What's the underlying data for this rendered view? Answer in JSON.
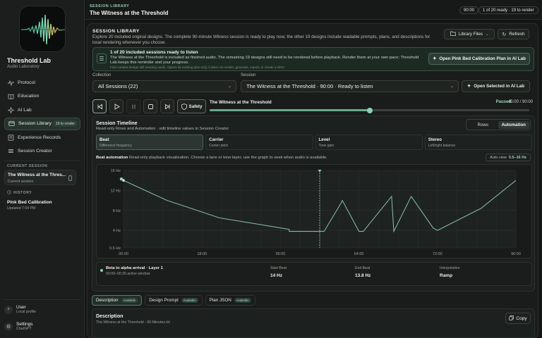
{
  "app": {
    "title": "Threshold Lab",
    "subtitle": "Audio Laboratory"
  },
  "sidebar": {
    "items": [
      {
        "label": "Protocol",
        "icon": "wave-icon"
      },
      {
        "label": "Education",
        "icon": "book-icon"
      },
      {
        "label": "AI Lab",
        "icon": "sparkle-icon"
      },
      {
        "label": "Session Library",
        "icon": "library-icon",
        "badge": "19 to render"
      },
      {
        "label": "Experience Records",
        "icon": "records-icon"
      },
      {
        "label": "Session Creator",
        "icon": "layers-icon"
      }
    ],
    "current_session_label": "CURRENT SESSION",
    "current_session_title": "The Witness at the Thres...",
    "current_session_sub": "Current session",
    "history_label": "HISTORY",
    "history_title": "Pink Bed Calibration",
    "history_sub": "Updated 7:04 PM",
    "user_label": "User",
    "user_sub": "Local profile",
    "settings_label": "Settings",
    "settings_sub": "ChatGPT"
  },
  "header": {
    "breadcrumb": "SESSION LIBRARY",
    "title": "The Witness at the Threshold",
    "duration_pill": "90:00",
    "ready_pill": "1 of 20 ready · 19 to render"
  },
  "library": {
    "title": "SESSION LIBRARY",
    "description": "Explore 20 included original designs. The complete 90-minute Witness session is ready to play now; the other 19 designs include readable prompts, plans, and descriptions for local rendering whenever you choose.",
    "files_button": "Library Files",
    "refresh_button": "Refresh",
    "notice_heading": "1 of 20 included sessions ready to listen",
    "notice_body": "The Witness at the Threshold is included as finished audio. The remaining 19 designs still need to be rendered before playback. Render them at your own pace; Threshold Lab keeps this reminder and your progress.",
    "notice_footer": "Find curated design still needing audio. Opens its existing plan only; it does not render, generate, export, or create a WAV.",
    "notice_cta": "Open Pink Bed Calibration Plan in AI Lab",
    "collection_label": "Collection",
    "collection_value": "All Sessions (22)",
    "session_label": "Session",
    "session_value": "The Witness at the Threshold · 90:00 · Ready to listen",
    "open_selected": "Open Selected in AI Lab"
  },
  "player": {
    "safety_label": "Safety",
    "track_title": "The Witness at the Threshold",
    "status": "Paused",
    "time": "45:00 / 90:00",
    "progress": 0.5
  },
  "timeline": {
    "title": "Session Timeline",
    "subtitle": "Read-only Rows and Automation · edit timeline values in Session Creator",
    "view_rows": "Rows",
    "view_automation": "Automation",
    "lanes": [
      {
        "name": "Beat",
        "sub": "Difference frequency"
      },
      {
        "name": "Carrier",
        "sub": "Center pitch"
      },
      {
        "name": "Level",
        "sub": "Tone gain"
      },
      {
        "name": "Stereo",
        "sub": "Left/right balance"
      }
    ],
    "automation_label": "Beat automation",
    "automation_desc": "Read-only playback visualization. Choose a lane or tone layer; use the graph to seek when audio is available.",
    "auto_view_label": "Auto view",
    "auto_view_range": "0.5–16 Hz",
    "info": {
      "segment_title": "Beta to alpha arrival · Layer 1",
      "segment_window": "00:00–00:30 active window",
      "start_label": "Start Beat",
      "start_value": "14 Hz",
      "end_label": "End Beat",
      "end_value": "13.8 Hz",
      "interp_label": "Interpolation",
      "interp_value": "Ramp"
    }
  },
  "chart_data": {
    "type": "line",
    "ylabel": "",
    "xlabel": "",
    "yticks": [
      "16 Hz",
      "12 Hz",
      "8 Hz",
      "4 Hz",
      "0.5 Hz"
    ],
    "ytick_values": [
      16,
      12,
      8,
      4,
      0.5
    ],
    "xticks": [
      "00:00",
      "18:00",
      "36:00",
      "54:00",
      "72:00",
      "90:00"
    ],
    "xtick_values": [
      0,
      18,
      36,
      54,
      72,
      90
    ],
    "xlim": [
      0,
      90
    ],
    "ylim": [
      0.5,
      16
    ],
    "playhead": 45,
    "series": [
      {
        "x": [
          0,
          10,
          22,
          38,
          38,
          45,
          46,
          50,
          50.2,
          54,
          55,
          61.5,
          62,
          66,
          71,
          72,
          82,
          90
        ],
        "y": [
          14,
          10,
          6.5,
          4.2,
          3.8,
          3.8,
          3.8,
          9.6,
          10,
          3.8,
          3.8,
          10.8,
          3.8,
          10.8,
          4.5,
          4,
          8.4,
          14
        ]
      }
    ]
  },
  "bottom": {
    "tabs": [
      {
        "label": "Description",
        "tag": "Available"
      },
      {
        "label": "Design Prompt",
        "tag": "Available"
      },
      {
        "label": "Plan JSON",
        "tag": "Available"
      }
    ],
    "desc_title": "Description",
    "desc_file": "The Witness at the Threshold - 90-Minutes.txt",
    "copy_label": "Copy"
  }
}
